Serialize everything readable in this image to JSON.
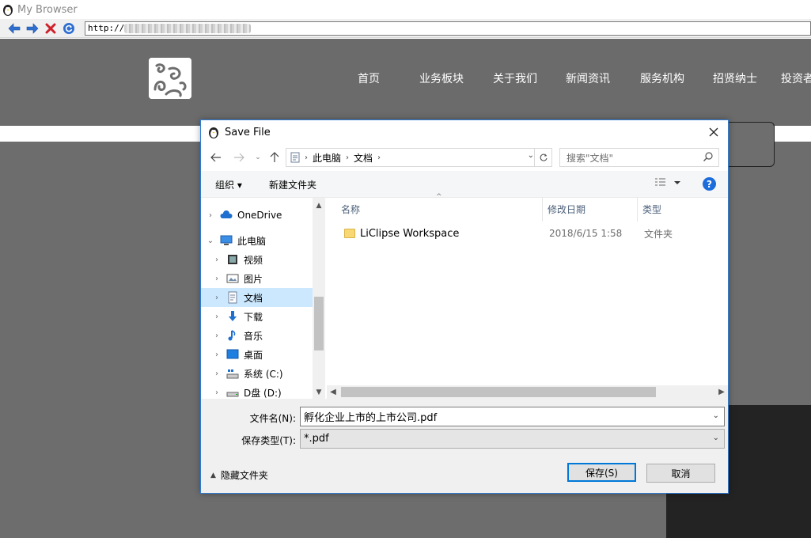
{
  "browser": {
    "title": "My Browser",
    "url_prefix": "http://"
  },
  "site": {
    "nav": [
      "首页",
      "业务板块",
      "关于我们",
      "新闻资讯",
      "服务机构",
      "招贤纳士",
      "投资者"
    ]
  },
  "dialog": {
    "title": "Save File",
    "breadcrumb": [
      "此电脑",
      "文档"
    ],
    "search_placeholder": "搜索\"文档\"",
    "toolbar": {
      "organize": "组织 ▾",
      "new_folder": "新建文件夹"
    },
    "nav_tree": [
      {
        "label": "OneDrive",
        "icon": "cloud-icon",
        "chevron": "›",
        "selected": false,
        "indent": 0
      },
      {
        "label": "此电脑",
        "icon": "computer-icon",
        "chevron": "⌄",
        "selected": false,
        "indent": 0
      },
      {
        "label": "视频",
        "icon": "video-icon",
        "chevron": "›",
        "selected": false,
        "indent": 1
      },
      {
        "label": "图片",
        "icon": "picture-icon",
        "chevron": "›",
        "selected": false,
        "indent": 1
      },
      {
        "label": "文档",
        "icon": "document-icon",
        "chevron": "›",
        "selected": true,
        "indent": 1
      },
      {
        "label": "下载",
        "icon": "download-icon",
        "chevron": "›",
        "selected": false,
        "indent": 1
      },
      {
        "label": "音乐",
        "icon": "music-icon",
        "chevron": "›",
        "selected": false,
        "indent": 1
      },
      {
        "label": "桌面",
        "icon": "desktop-icon",
        "chevron": "›",
        "selected": false,
        "indent": 1
      },
      {
        "label": "系统 (C:)",
        "icon": "system-drive-icon",
        "chevron": "›",
        "selected": false,
        "indent": 1
      },
      {
        "label": "D盘 (D:)",
        "icon": "drive-icon",
        "chevron": "›",
        "selected": false,
        "indent": 1
      }
    ],
    "columns": [
      "名称",
      "修改日期",
      "类型"
    ],
    "files": [
      {
        "name": "LiClipse Workspace",
        "date": "2018/6/15 1:58",
        "type": "文件夹"
      }
    ],
    "filename_label": "文件名(N):",
    "filename_value": "孵化企业上市的上市公司.pdf",
    "filetype_label": "保存类型(T):",
    "filetype_value": "*.pdf",
    "hide_folders": "隐藏文件夹",
    "save_button": "保存(S)",
    "cancel_button": "取消"
  },
  "colors": {
    "accent": "#0078d7",
    "selection": "#cce8ff",
    "site_bg": "#6d6d6d"
  }
}
